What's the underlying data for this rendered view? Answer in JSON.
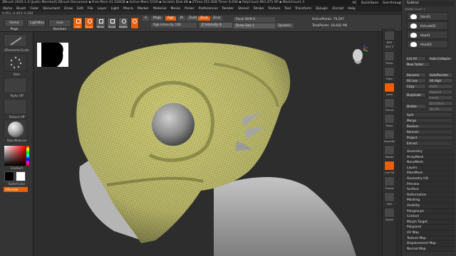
{
  "titlebar": {
    "text": "ZBrush 2020.1.4 [Justin Marshall]   ZBrush Document   ▪ Free Mem 41.518GB ▪ Active Mem 5319 ▪ Scratch Disk 48 ▪ ZTime 251.928 Timer 0.004 ▪ PolyCount 963.471 KP ▪ MeshCount 3",
    "right_items": [
      "AC",
      "QuickSave",
      "See-through 0"
    ],
    "menus_label": "Menus",
    "default_script": "DefaultZScript"
  },
  "menubar": {
    "items": [
      "Alpha",
      "Brush",
      "Color",
      "Document",
      "Draw",
      "Edit",
      "File",
      "Layer",
      "Light",
      "Macro",
      "Marker",
      "Material",
      "Movie",
      "Picker",
      "Preferences",
      "Render",
      "Stencil",
      "Stroke",
      "Texture",
      "Tool",
      "Transform",
      "Zplugin",
      "Zscript",
      "Help"
    ]
  },
  "coords": "0.051,-0.403,-0.284",
  "shelf": {
    "home_page": "Home Page",
    "lightbox": "LightBox",
    "live_boolean": "Live Boolean",
    "tools": [
      {
        "label": "Edit",
        "active": true
      },
      {
        "label": "Draw",
        "active": true
      },
      {
        "label": "Move",
        "active": false
      },
      {
        "label": "Scale",
        "active": false
      },
      {
        "label": "Rotate",
        "active": false
      }
    ],
    "a_label": "A",
    "mrgb": "Mrgb",
    "rgb": "Rgb",
    "m": "M",
    "zadd": "Zadd",
    "zsub": "Zsub",
    "zcut": "Zcut",
    "rgb_intensity": "Rgb Intensity 100",
    "z_intensity": "Z Intensity 6",
    "focal_shift": "Focal Shift 0",
    "draw_size": "Draw Size 1",
    "dynamic": "Dynamic",
    "active_points": "ActivePoints: 79,297",
    "total_points": "TotalPoints: 18.642 Mil"
  },
  "left_panel": {
    "brush_label": "ZRemesherGuide",
    "stroke_label": "Dots",
    "alpha_label": "Alpha Off",
    "texture_label": "Texture Off",
    "material_label": "BasicMaterial",
    "gradient_label": "Gradient",
    "switch_color": "SwitchColor",
    "alternate": "Alternate"
  },
  "right_tools": {
    "labels": [
      "BPR",
      "SPix 3",
      "Persp",
      "Floor",
      "Local",
      "Frame",
      "Move",
      "Zoom3D",
      "Rotate",
      "Line Fill",
      "Transp",
      "Solo",
      "Xpose"
    ]
  },
  "subtool_panel": {
    "title": "Subtool",
    "visible_count": "Visible Count 7",
    "items": [
      {
        "name": "Skin01"
      },
      {
        "name": "Extrude02"
      },
      {
        "name": "Head1"
      },
      {
        "name": "Head01"
      }
    ],
    "list_all": "List All",
    "auto_collapse": "Auto Collapse",
    "new_folder": "New Folder",
    "rename": "Rename",
    "auto_reorder": "AutoReorder",
    "all_low": "All Low",
    "all_high": "All High",
    "copy": "Copy",
    "paste": "Paste",
    "append": "Append",
    "duplicate": "Duplicate",
    "insert": "Insert",
    "delete": "Delete",
    "del_other": "Del Other",
    "del_all": "Del All",
    "split": "Split",
    "merge": "Merge",
    "boolean": "Boolean",
    "remesh": "Remesh",
    "project": "Project",
    "extract": "Extract"
  },
  "tool_menu": {
    "items": [
      "Geometry",
      "ArrayMesh",
      "NanoMesh",
      "Layers",
      "FiberMesh",
      "Geometry HD",
      "Preview",
      "Surface",
      "Deformation",
      "Masking",
      "Visibility",
      "Polygroups",
      "Contact",
      "Morph Target",
      "Polypaint",
      "UV Map",
      "Texture Map",
      "Displacement Map",
      "Normal Map"
    ]
  },
  "colors": {
    "accent": "#e8600c",
    "mesh": "#d2cf78",
    "wire": "#56562a",
    "eye": "#8e8e8e",
    "neck": "#a9a9a9"
  }
}
